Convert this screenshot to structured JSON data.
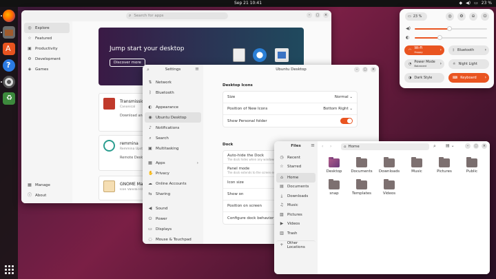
{
  "topbar": {
    "datetime": "Sep 21 10:41",
    "battery": "23 %"
  },
  "dock": {
    "items": [
      "firefox-icon",
      "files-icon",
      "app-center-icon",
      "help-icon",
      "settings-icon",
      "trash-icon",
      "show-apps-icon"
    ]
  },
  "appcenter": {
    "search_placeholder": "Search for apps",
    "sidebar": [
      {
        "label": "Explore",
        "icon": "compass-icon"
      },
      {
        "label": "Featured",
        "icon": "star-icon"
      },
      {
        "label": "Productivity",
        "icon": "briefcase-icon"
      },
      {
        "label": "Development",
        "icon": "code-icon"
      },
      {
        "label": "Games",
        "icon": "gamepad-icon"
      }
    ],
    "sidebar_bottom": [
      {
        "label": "Manage",
        "icon": "grid-icon"
      },
      {
        "label": "About",
        "icon": "info-icon"
      }
    ],
    "banner": {
      "title": "Jump start your desktop",
      "button": "Discover more"
    },
    "cards": [
      {
        "name": "Transmission",
        "publisher": "Canonical",
        "action": "Download and"
      },
      {
        "name": "remmina",
        "publisher": "Remmina Upstream",
        "action": "Remote Desk"
      },
      {
        "name": "GNOME Mahjongg",
        "publisher": "Icon Vanilla Framework",
        "action": ""
      }
    ]
  },
  "settings": {
    "title": "Settings",
    "page_title": "Ubuntu Desktop",
    "sidebar": [
      {
        "label": "Network",
        "icon": "network-icon"
      },
      {
        "label": "Bluetooth",
        "icon": "bluetooth-icon"
      },
      {
        "label": "Appearance",
        "icon": "palette-icon"
      },
      {
        "label": "Ubuntu Desktop",
        "icon": "ubuntu-icon"
      },
      {
        "label": "Notifications",
        "icon": "bell-icon"
      },
      {
        "label": "Search",
        "icon": "search-icon"
      },
      {
        "label": "Multitasking",
        "icon": "windows-icon"
      },
      {
        "label": "Apps",
        "icon": "apps-icon"
      },
      {
        "label": "Privacy",
        "icon": "hand-icon"
      },
      {
        "label": "Online Accounts",
        "icon": "cloud-icon"
      },
      {
        "label": "Sharing",
        "icon": "share-icon"
      },
      {
        "label": "Sound",
        "icon": "speaker-icon"
      },
      {
        "label": "Power",
        "icon": "power-icon"
      },
      {
        "label": "Displays",
        "icon": "display-icon"
      },
      {
        "label": "Mouse & Touchpad",
        "icon": "mouse-icon"
      }
    ],
    "desktop_icons": {
      "heading": "Desktop Icons",
      "size_label": "Size",
      "size_value": "Normal",
      "position_label": "Position of New Icons",
      "position_value": "Bottom Right",
      "personal_folder_label": "Show Personal folder",
      "personal_folder_on": true
    },
    "dock": {
      "heading": "Dock",
      "autohide_label": "Auto-hide the Dock",
      "autohide_desc": "The dock hides when any windows touch it",
      "panel_label": "Panel mode",
      "panel_desc": "The dock extends to the screen edge",
      "icon_size_label": "Icon size",
      "show_on_label": "Show on",
      "position_label": "Position on screen",
      "configure_label": "Configure dock behavior"
    }
  },
  "files": {
    "title": "Files",
    "location": "Home",
    "sidebar": [
      {
        "label": "Recent",
        "icon": "clock-icon"
      },
      {
        "label": "Starred",
        "icon": "star-icon"
      },
      {
        "label": "Home",
        "icon": "home-icon"
      },
      {
        "label": "Documents",
        "icon": "document-icon"
      },
      {
        "label": "Downloads",
        "icon": "download-icon"
      },
      {
        "label": "Music",
        "icon": "music-icon"
      },
      {
        "label": "Pictures",
        "icon": "image-icon"
      },
      {
        "label": "Videos",
        "icon": "video-icon"
      },
      {
        "label": "Trash",
        "icon": "trash-icon"
      }
    ],
    "other_locations": "Other Locations",
    "folders": [
      "Desktop",
      "Documents",
      "Downloads",
      "Music",
      "Pictures",
      "Public",
      "snap",
      "Templates",
      "Videos"
    ]
  },
  "quick_settings": {
    "battery": "23 %",
    "wifi": {
      "label": "Wi-Fi",
      "sub": "Hoppy"
    },
    "bluetooth": "Bluetooth",
    "power_mode": {
      "label": "Power Mode",
      "sub": "Balanced"
    },
    "night_light": "Night Light",
    "dark_style": "Dark Style",
    "keyboard": "Keyboard",
    "volume_level": 0.48,
    "brightness_level": 0.34,
    "colors": {
      "accent": "#e95420"
    }
  }
}
